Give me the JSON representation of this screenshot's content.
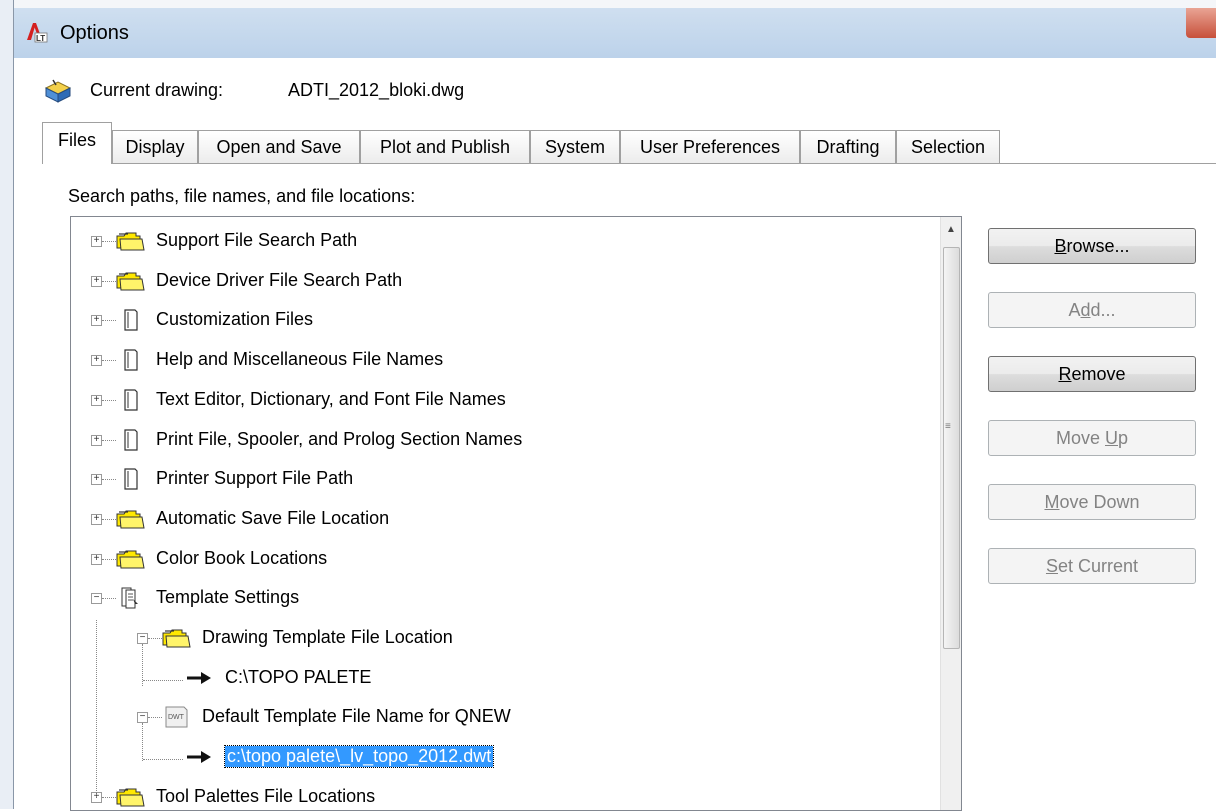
{
  "window": {
    "title": "Options"
  },
  "current_drawing": {
    "label": "Current drawing:",
    "value": "ADTI_2012_bloki.dwg"
  },
  "tabs": [
    {
      "label": "Files",
      "active": true
    },
    {
      "label": "Display"
    },
    {
      "label": "Open and Save"
    },
    {
      "label": "Plot and Publish"
    },
    {
      "label": "System"
    },
    {
      "label": "User Preferences"
    },
    {
      "label": "Drafting"
    },
    {
      "label": "Selection"
    }
  ],
  "section_label": "Search paths, file names, and file locations:",
  "tree": [
    {
      "label": "Support File Search Path",
      "icon": "folders-icon",
      "level": 0,
      "expander": "plus"
    },
    {
      "label": "Device Driver File Search Path",
      "icon": "folders-icon",
      "level": 0,
      "expander": "plus"
    },
    {
      "label": "Customization Files",
      "icon": "document-icon",
      "level": 0,
      "expander": "plus"
    },
    {
      "label": "Help and Miscellaneous File Names",
      "icon": "document-icon",
      "level": 0,
      "expander": "plus"
    },
    {
      "label": "Text Editor, Dictionary, and Font File Names",
      "icon": "document-icon",
      "level": 0,
      "expander": "plus"
    },
    {
      "label": "Print File, Spooler, and Prolog Section Names",
      "icon": "document-icon",
      "level": 0,
      "expander": "plus"
    },
    {
      "label": "Printer Support File Path",
      "icon": "document-icon",
      "level": 0,
      "expander": "plus"
    },
    {
      "label": "Automatic Save File Location",
      "icon": "folders-icon",
      "level": 0,
      "expander": "plus"
    },
    {
      "label": "Color Book Locations",
      "icon": "folders-icon",
      "level": 0,
      "expander": "plus"
    },
    {
      "label": "Template Settings",
      "icon": "documents-icon",
      "level": 0,
      "expander": "minus"
    },
    {
      "label": "Drawing Template File Location",
      "icon": "folders-icon",
      "level": 1,
      "expander": "minus"
    },
    {
      "label": "C:\\TOPO PALETE",
      "icon": "arrow-icon",
      "level": 2
    },
    {
      "label": "Default Template File Name for QNEW",
      "icon": "dwt-file-icon",
      "level": 1,
      "expander": "minus"
    },
    {
      "label": "c:\\topo palete\\_lv_topo_2012.dwt",
      "icon": "arrow-icon",
      "level": 2,
      "selected": true
    },
    {
      "label": "Tool Palettes File Locations",
      "icon": "folders-icon",
      "level": 0,
      "expander": "plus"
    }
  ],
  "buttons": {
    "browse": {
      "pre": "",
      "u": "B",
      "post": "rowse...",
      "enabled": true
    },
    "add": {
      "pre": "A",
      "u": "d",
      "post": "d...",
      "enabled": false
    },
    "remove": {
      "pre": "",
      "u": "R",
      "post": "emove",
      "enabled": true
    },
    "move_up": {
      "pre": "Move ",
      "u": "U",
      "post": "p",
      "enabled": false
    },
    "move_down": {
      "pre": "",
      "u": "M",
      "post": "ove Down",
      "enabled": false
    },
    "set_current": {
      "pre": "",
      "u": "S",
      "post": "et Current",
      "enabled": false
    }
  },
  "colors": {
    "selection": "#3399ff",
    "folder_yellow": "#ffe800",
    "titlebar": "#c4d8ee"
  }
}
